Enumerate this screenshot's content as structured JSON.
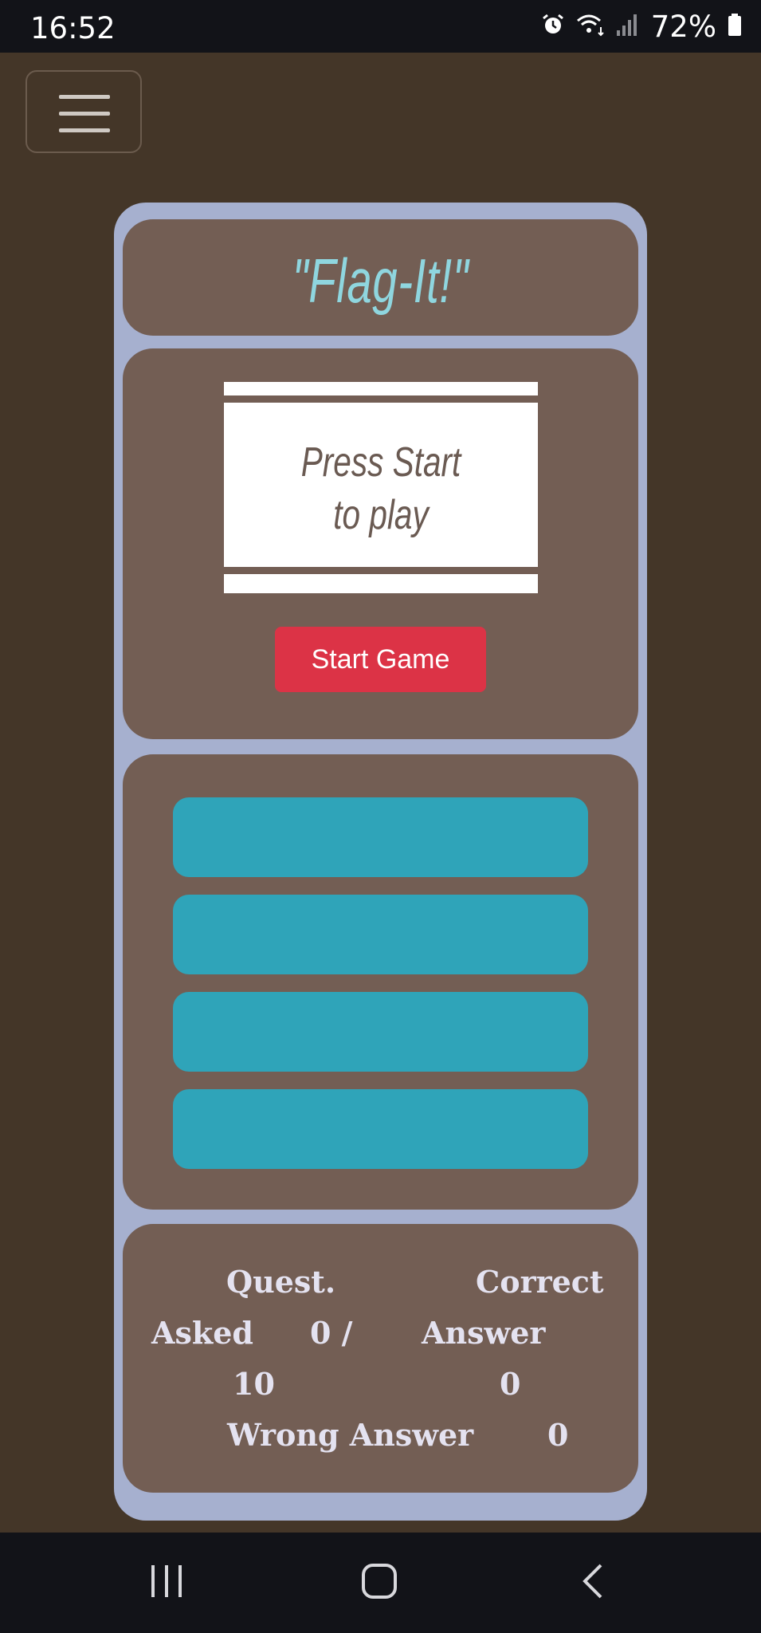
{
  "status_bar": {
    "time": "16:52",
    "battery_percent": "72%",
    "icons": [
      "alarm-icon",
      "wifi-icon",
      "signal-icon",
      "battery-icon"
    ]
  },
  "menu": {
    "icon": "hamburger-menu-icon"
  },
  "game": {
    "title": "\"Flag-It!\"",
    "flag_prompt_line1": "Press Start",
    "flag_prompt_line2": "to play",
    "start_button": "Start Game",
    "answer_buttons": [
      "",
      "",
      "",
      ""
    ]
  },
  "score": {
    "quest_label_1": "Quest.",
    "quest_label_2": "Asked",
    "quest_value": "0 /",
    "quest_total": "10",
    "correct_label_1": "Correct",
    "correct_label_2": "Answer",
    "correct_value": "0",
    "wrong_label": "Wrong Answer",
    "wrong_value": "0"
  },
  "nav_bar": {
    "icons": [
      "recent-apps-icon",
      "home-icon",
      "back-icon"
    ]
  },
  "colors": {
    "background": "#443628",
    "container": "#a6b0cf",
    "panel": "#735e54",
    "title": "#8fd6df",
    "start_button": "#dc3346",
    "answer_button": "#2fa4b9",
    "score_text": "#e4e2f0"
  }
}
